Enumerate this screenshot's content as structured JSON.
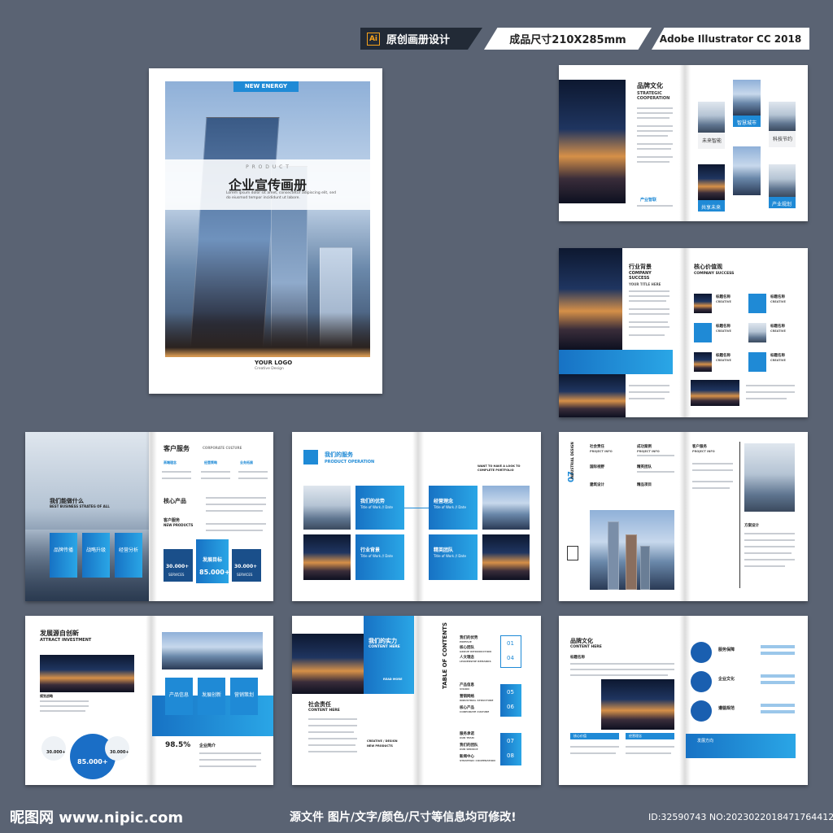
{
  "header": {
    "tag1": "原创画册设计",
    "tag1_icon": "Ai",
    "tag2": "成品尺寸210X285mm",
    "tag3": "Adobe Illustrator CC 2018"
  },
  "cover": {
    "badge": "NEW ENERGY",
    "product": "P R O D U C T",
    "title": "企业宣传画册",
    "desc": "Lorem ipsum dolor sit amet, consectetur adipiscing elit, sed do eiusmod tempor incididunt ut labore.",
    "logo": "YOUR LOGO",
    "logo_sub": "Creative Design"
  },
  "spread1": {
    "title": "品牌文化",
    "sub": "STRATEGIC COOPERATION",
    "tag": "产业智联",
    "captions": [
      "未来智能",
      "智慧城市",
      "科技节约",
      "共享未来",
      "产业规划"
    ]
  },
  "spread2": {
    "title": "行业背景",
    "sub": "COMPANY SUCCESS",
    "sub2": "YOUR TITLE HERE",
    "title2": "核心价值观",
    "sub3": "COMPANY SUCCESS",
    "items": [
      "标题名称",
      "标题名称",
      "标题名称",
      "标题名称",
      "标题名称",
      "标题名称"
    ],
    "item_sub": "CREATIVE"
  },
  "spread3": {
    "title": "客户服务",
    "sub": "CORPORATE CULTURE",
    "left_title": "我们能做什么",
    "left_sub": "BEST BUSINESS STRATEG OF ALL",
    "cards": [
      "品牌传播",
      "战略升级",
      "经营分析"
    ],
    "icons_labels": [
      "高端理念",
      "经营策略",
      "业务拓展"
    ],
    "core": "核心产品",
    "client": "客户服务",
    "client_sub": "NEW PRODUCTS",
    "stat1": "30.000+",
    "stat1_sub": "SERVICES",
    "stat2_title": "发展目标",
    "stat2": "85.000+",
    "stat3": "30.000+",
    "stat3_sub": "SERVICES"
  },
  "spread4": {
    "title": "我们的服务",
    "sub": "PRODUCT OPERATION",
    "right_top": "WANT TO HAVE A LOOK TO COMPLETE PORTFOLIO",
    "boxes": [
      "我们的优势",
      "经营理念",
      "行业背景",
      "精英团队"
    ],
    "box_sub": "Title of Work // Date"
  },
  "spread5": {
    "num": "07",
    "side": "INDUSTRIAL DESIGN",
    "items": [
      "社会责任",
      "成功案例",
      "国际视野",
      "精英团队",
      "建筑设计",
      "精品项目",
      "客户服务"
    ],
    "item_sub": "PROJECT INFO",
    "plan": "方案设计"
  },
  "spread6": {
    "title": "发展源自创新",
    "sub": "ATTRACT INVESTMENT",
    "label": "规划战略",
    "cards": [
      "产品信息",
      "发展创新",
      "营销策划"
    ],
    "big_top": "85.000+",
    "small1": "30.000+",
    "small2": "30.000+",
    "pct": "98.5%",
    "intro": "企业简介"
  },
  "spread7": {
    "title": "我们的实力",
    "sub": "CONTENT HERE",
    "read": "READ MORE",
    "resp": "社会责任",
    "resp_sub": "CONTENT HERE",
    "creative": "CREATIVE / DESIGN",
    "creative_sub": "NEW PRODUCTS",
    "toc": "TABLE OF CONTENTS",
    "entries": [
      "我们的优势",
      "核心团队",
      "人文理念",
      "产品信息",
      "营销网络",
      "核心产品",
      "服务承诺",
      "我们的团队",
      "新闻中心"
    ],
    "entry_subs": [
      "PREFACE",
      "GROUP INTRODUCTION",
      "LEADERSHIP REMARKS",
      "VISION",
      "INDUSTRIAL STRUCTURE",
      "CORPORATE CULTURE",
      "OUR TEAM",
      "OUR SERVICE",
      "STRATEGIC COOPERATION"
    ],
    "nums": [
      "01",
      "04",
      "05",
      "06",
      "07",
      "08"
    ]
  },
  "spread8": {
    "title": "品牌文化",
    "sub": "CONTENT HERE",
    "label": "标题名称",
    "cap1": "核心价值",
    "cap2": "经营理念",
    "services": [
      "服务保障",
      "企业文化",
      "遵循规范"
    ],
    "quote": "发展方向"
  },
  "footer": {
    "logo": "昵图网 www.nipic.com",
    "notice": "源文件 图片/文字/颜色/尺寸等信息均可修改!",
    "id": "ID:32590743 NO:20230220184717644121"
  },
  "colors": {
    "background": "#5a6373",
    "accent": "#1f8ad6",
    "dark_tag": "#222a36"
  }
}
